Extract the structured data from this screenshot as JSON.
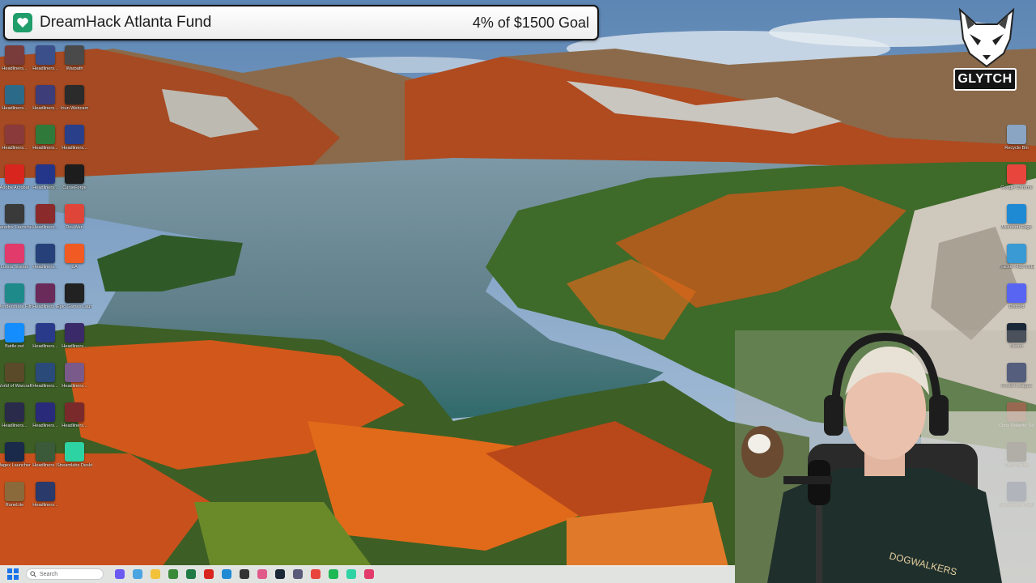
{
  "donation_overlay": {
    "title": "DreamHack Atlanta Fund",
    "progress_text": "4% of $1500 Goal",
    "icon": "donation-heart-icon",
    "accent_color": "#1f9d6a"
  },
  "channel_logo": {
    "text": "GLYTCH",
    "icon": "fox-mascot-icon"
  },
  "desktop_icons": [
    {
      "label": "Headliners...",
      "color": "#7a3b3b"
    },
    {
      "label": "Headliners...",
      "color": "#3b4f8a"
    },
    {
      "label": "Warpath",
      "color": "#4a4a4a"
    },
    {
      "label": "Headliners...",
      "color": "#2c6a8a"
    },
    {
      "label": "Headliners...",
      "color": "#3d3d7a"
    },
    {
      "label": "Iriun Webcam",
      "color": "#2b2b2b"
    },
    {
      "label": "Headliners...",
      "color": "#8a3a3a"
    },
    {
      "label": "Headliners...",
      "color": "#2f7a3a"
    },
    {
      "label": "Headliners...",
      "color": "#2a3f8a"
    },
    {
      "label": "Adobe Acrobat",
      "color": "#d8261f"
    },
    {
      "label": "Headliners...",
      "color": "#24368a"
    },
    {
      "label": "CurseForge",
      "color": "#1d1d1d"
    },
    {
      "label": "Paradox Launcher v2",
      "color": "#3a3a3a"
    },
    {
      "label": "Headliners...",
      "color": "#8a2a2a"
    },
    {
      "label": "DouWan",
      "color": "#e0453a"
    },
    {
      "label": "Lumia Stream",
      "color": "#e23a6a"
    },
    {
      "label": "Headliners...",
      "color": "#26417a"
    },
    {
      "label": "EA",
      "color": "#f25a24"
    },
    {
      "label": "Wondershare Filmora 14",
      "color": "#1e8a8a"
    },
    {
      "label": "Headliners...",
      "color": "#6a2a5a"
    },
    {
      "label": "Epic Games Launcher",
      "color": "#222222"
    },
    {
      "label": "Battle.net",
      "color": "#148eff"
    },
    {
      "label": "Headliners...",
      "color": "#2a3a8a"
    },
    {
      "label": "Headliners...",
      "color": "#3a2a6a"
    },
    {
      "label": "World of Warcraft",
      "color": "#5a4a2a"
    },
    {
      "label": "Headliners...",
      "color": "#2a4a7a"
    },
    {
      "label": "Headliners...",
      "color": "#7a5a8a"
    },
    {
      "label": "Headliners...",
      "color": "#2a2a4a"
    },
    {
      "label": "Headliners...",
      "color": "#2a2a7a"
    },
    {
      "label": "Headliners...",
      "color": "#7a2a2a"
    },
    {
      "label": "Jagex Launcher",
      "color": "#1a2a4a"
    },
    {
      "label": "Headliners...",
      "color": "#3a5a3a"
    },
    {
      "label": "Streamlabs Desktop",
      "color": "#2ed3a4"
    },
    {
      "label": "RuneLite",
      "color": "#8a6a3a"
    },
    {
      "label": "Headliners...",
      "color": "#2a3a6a"
    }
  ],
  "right_icons": [
    {
      "label": "Recycle Bin",
      "color": "#8aa4c4"
    },
    {
      "label": "Google Chrome",
      "color": "#e8453c"
    },
    {
      "label": "Microsoft Edge",
      "color": "#1f8ad4"
    },
    {
      "label": "Tracker Hub Installer",
      "color": "#3a9ad4"
    },
    {
      "label": "Discord",
      "color": "#5865f2"
    },
    {
      "label": "Steam",
      "color": "#1b2838"
    },
    {
      "label": "Rocket League",
      "color": "#2a3a6a"
    },
    {
      "label": "Chris Roberts' Squadron",
      "color": "#8a4a2a"
    },
    {
      "label": "OBS Studio",
      "color": "#2a2a2a"
    },
    {
      "label": "Streamlabs Chatbot",
      "color": "#2a4a8a"
    }
  ],
  "taskbar": {
    "search_placeholder": "Search",
    "start_icon": "windows-start-icon",
    "apps": [
      {
        "name": "discord-taskbar-icon",
        "color": "#6a5af2"
      },
      {
        "name": "copilot-taskbar-icon",
        "color": "#4aa4e0"
      },
      {
        "name": "file-explorer-taskbar-icon",
        "color": "#f2c23a"
      },
      {
        "name": "minecraft-taskbar-icon",
        "color": "#3a8a3a"
      },
      {
        "name": "excel-taskbar-icon",
        "color": "#1f7a44"
      },
      {
        "name": "adobe-taskbar-icon",
        "color": "#d8261f"
      },
      {
        "name": "edge-taskbar-icon",
        "color": "#1f8ad4"
      },
      {
        "name": "obs-taskbar-icon",
        "color": "#333333"
      },
      {
        "name": "paint-taskbar-icon",
        "color": "#e05a8a"
      },
      {
        "name": "steam-taskbar-icon",
        "color": "#1b2838"
      },
      {
        "name": "cursor-taskbar-icon",
        "color": "#5a5a7a"
      },
      {
        "name": "chrome-taskbar-icon",
        "color": "#e8453c"
      },
      {
        "name": "spotify-taskbar-icon",
        "color": "#1db954"
      },
      {
        "name": "streamlabs-taskbar-icon",
        "color": "#2ed3a4"
      },
      {
        "name": "lumia-taskbar-icon",
        "color": "#e23a6a"
      }
    ]
  }
}
